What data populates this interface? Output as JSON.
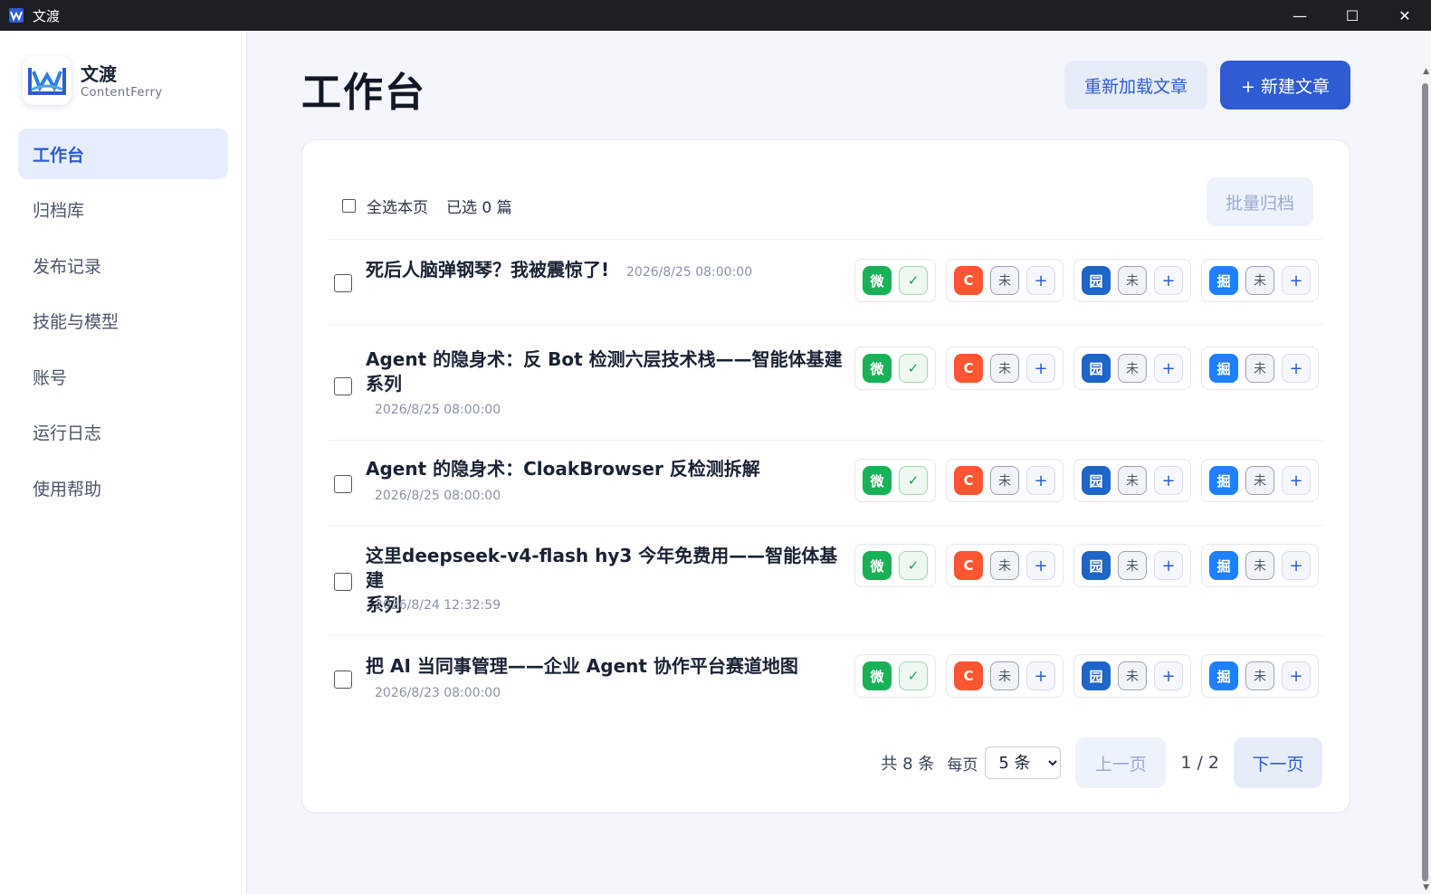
{
  "window": {
    "title": "文渡",
    "controls": {
      "minimize": "—",
      "maximize": "☐",
      "close": "✕"
    }
  },
  "brand": {
    "name": "文渡",
    "subtitle": "ContentFerry"
  },
  "sidebar": {
    "items": [
      {
        "label": "工作台",
        "active": true
      },
      {
        "label": "归档库"
      },
      {
        "label": "发布记录"
      },
      {
        "label": "技能与模型"
      },
      {
        "label": "账号"
      },
      {
        "label": "运行日志"
      },
      {
        "label": "使用帮助"
      }
    ]
  },
  "header": {
    "title": "工作台",
    "reload_label": "重新加载文章",
    "new_label": "+ 新建文章"
  },
  "toolbar": {
    "select_all_label": "全选本页",
    "selected_label": "已选 0 篇",
    "archive_label": "批量归档"
  },
  "platforms": {
    "wechat": {
      "label": "微",
      "status": "✓",
      "color": "#18b158"
    },
    "csdn": {
      "label": "C",
      "status": "未",
      "add": "+",
      "color": "#fc5531"
    },
    "cnblogs": {
      "label": "园",
      "status": "未",
      "add": "+",
      "color": "#1d65c8"
    },
    "juejin": {
      "label": "掘",
      "status": "未",
      "add": "+",
      "color": "#1e80ff"
    }
  },
  "articles": [
    {
      "title": "死后人脑弹钢琴？我被震惊了!",
      "date": "2026/8/25 08:00:00"
    },
    {
      "title_line1": "Agent 的隐身术：反 Bot 检测六层技术栈——智能体基建",
      "title_line2": "系列",
      "date": "2026/8/25 08:00:00"
    },
    {
      "title": "Agent 的隐身术：CloakBrowser 反检测拆解",
      "date": "2026/8/25 08:00:00"
    },
    {
      "title_line1": "这里deepseek-v4-flash hy3 今年免费用——智能体基建",
      "title_line2": "系列",
      "date": "2026/8/24 12:32:59"
    },
    {
      "title": "把 AI 当同事管理——企业 Agent 协作平台赛道地图",
      "date": "2026/8/23 08:00:00"
    }
  ],
  "pager": {
    "total": "共 8 条",
    "per_page_label": "每页",
    "per_page_value": "5 条",
    "prev": "上一页",
    "page": "1 / 2",
    "next": "下一页"
  }
}
